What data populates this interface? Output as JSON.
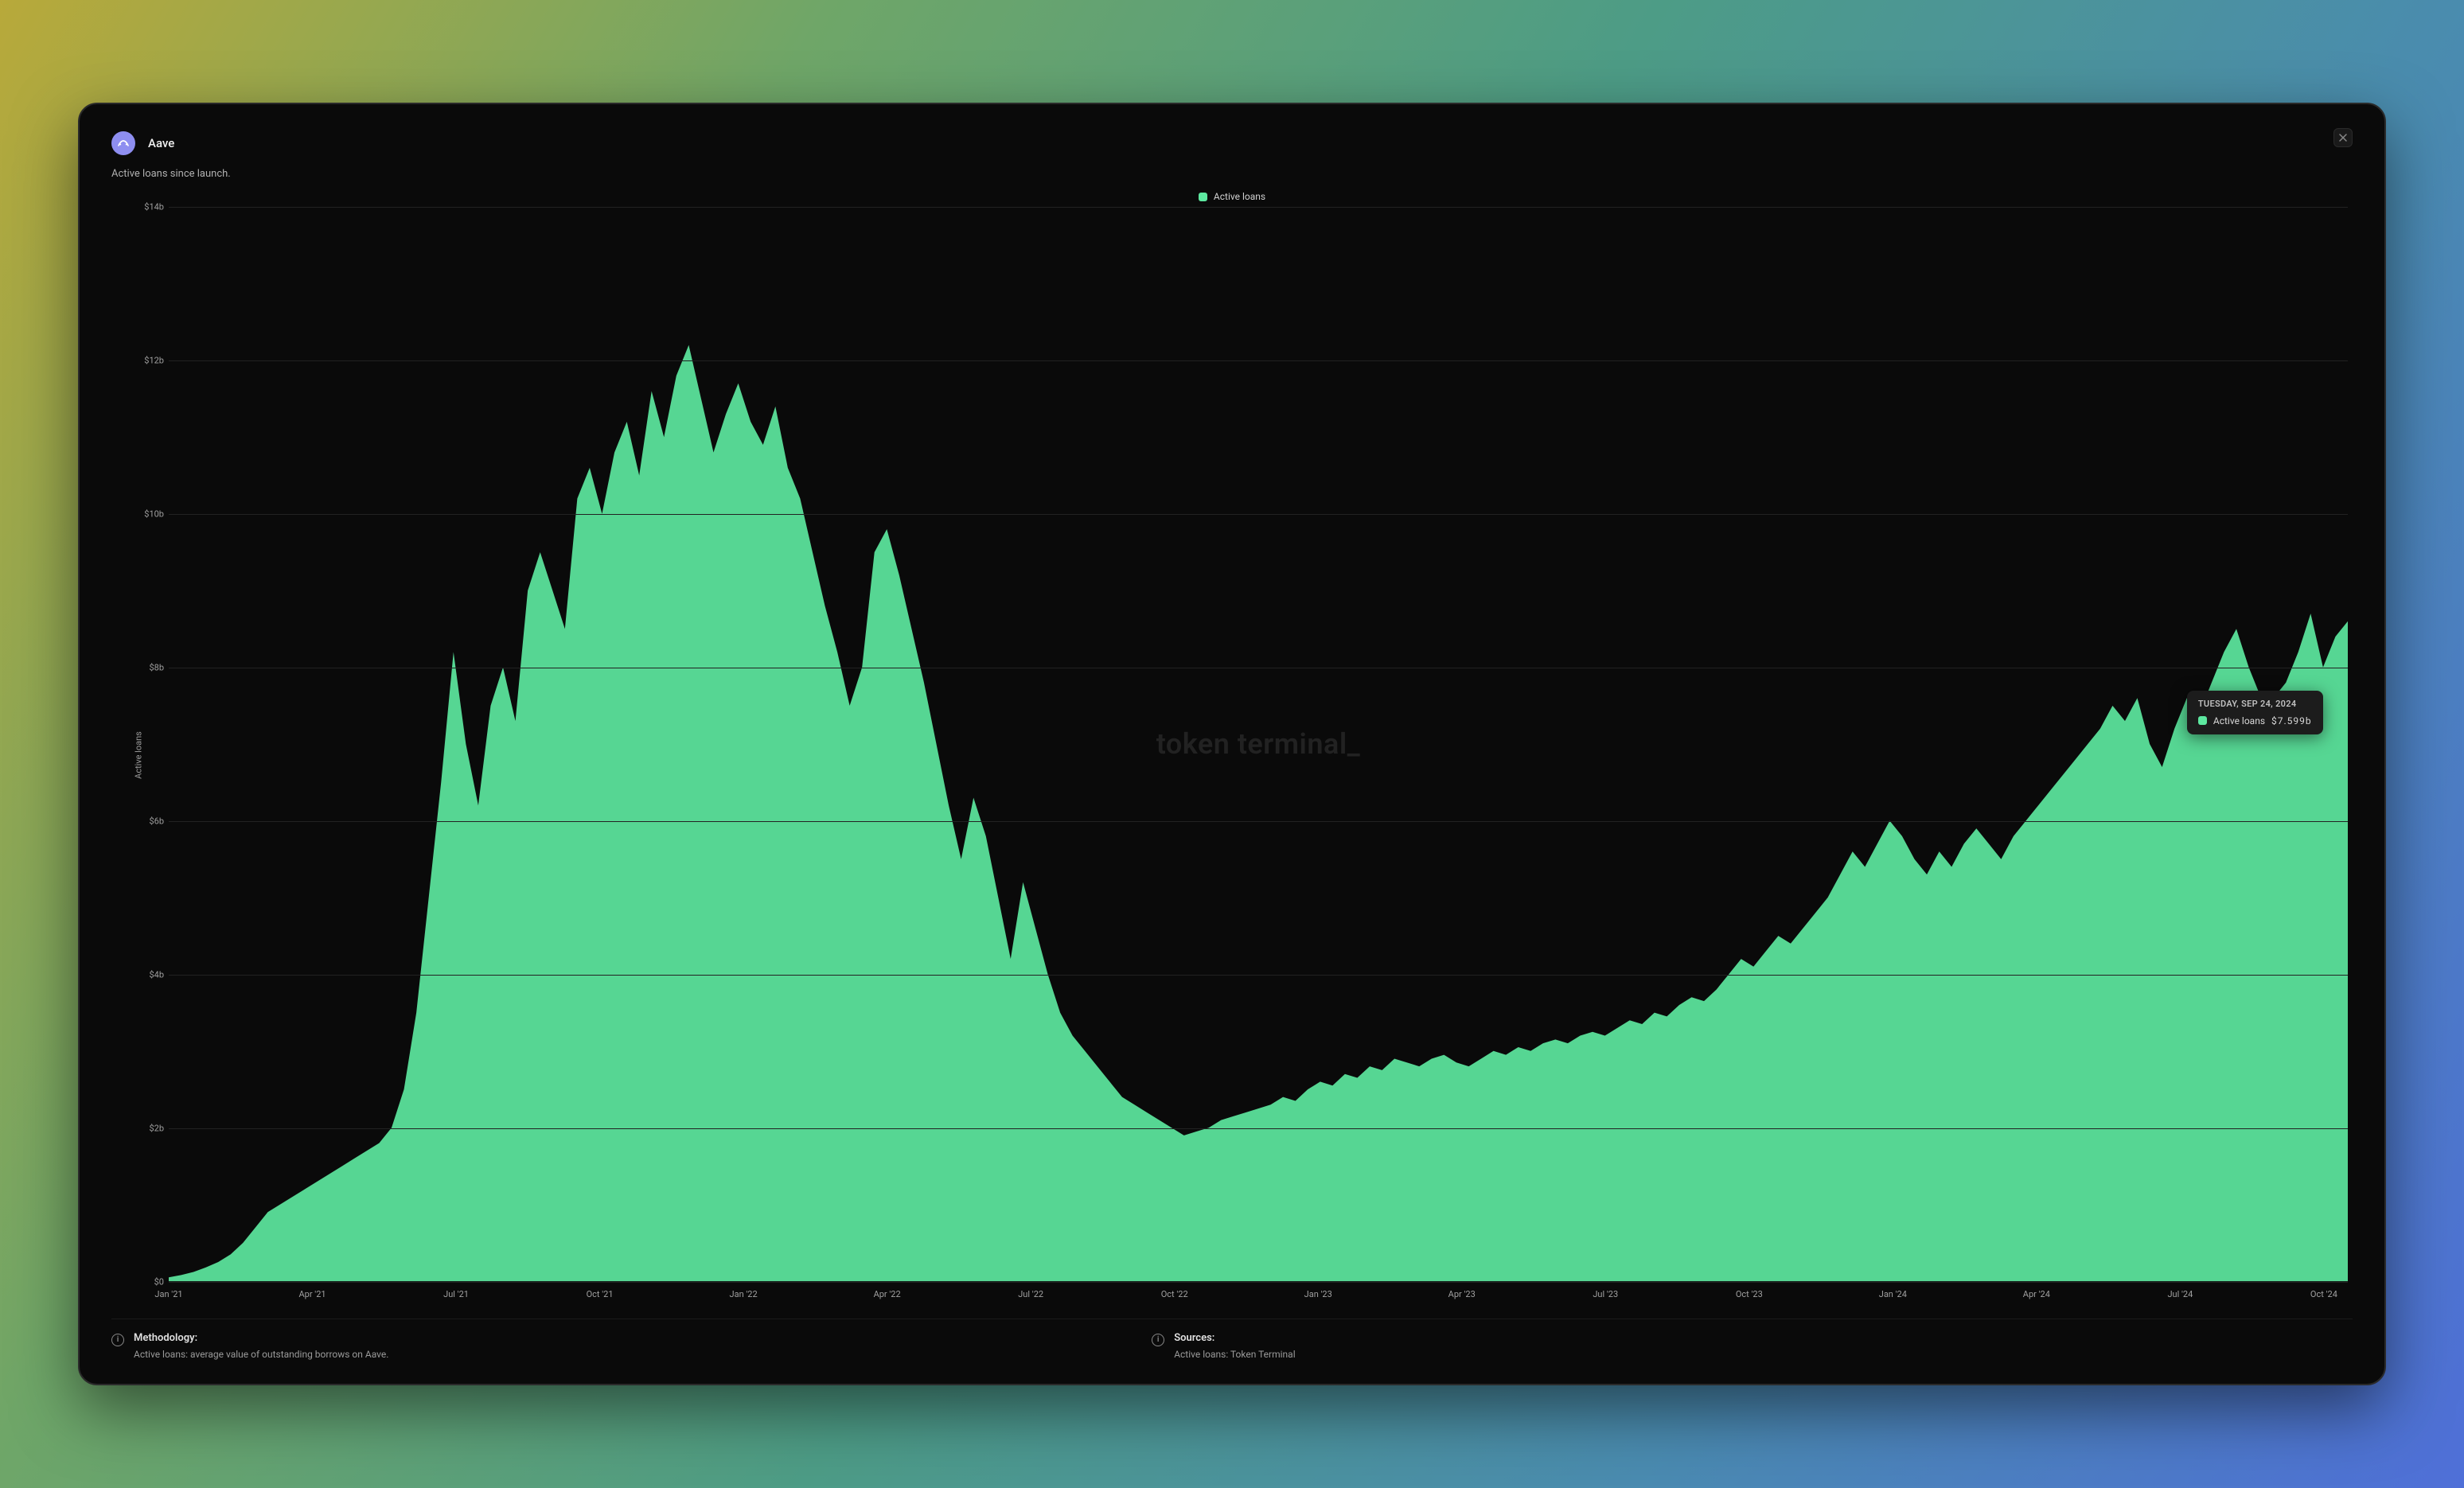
{
  "header": {
    "title": "Aave",
    "subtitle": "Active loans since launch."
  },
  "legend": {
    "series_label": "Active loans",
    "color": "#5de8a0"
  },
  "y_axis_label": "Active loans",
  "watermark": "token terminal_",
  "tooltip": {
    "date": "TUESDAY, SEP 24, 2024",
    "series": "Active loans",
    "value": "$7.599b"
  },
  "footer": {
    "methodology_heading": "Methodology:",
    "methodology_body": "Active loans: average value of outstanding borrows on Aave.",
    "sources_heading": "Sources:",
    "sources_body": "Active loans: Token Terminal"
  },
  "chart_data": {
    "type": "area",
    "title": "Aave — Active loans since launch",
    "xlabel": "",
    "ylabel": "Active loans",
    "ylim": [
      0,
      14
    ],
    "y_ticks": [
      0,
      2,
      4,
      6,
      8,
      10,
      12,
      14
    ],
    "y_tick_labels": [
      "$0",
      "$2b",
      "$4b",
      "$6b",
      "$8b",
      "$10b",
      "$12b",
      "$14b"
    ],
    "x_tick_labels": [
      "Jan '21",
      "Apr '21",
      "Jul '21",
      "Oct '21",
      "Jan '22",
      "Apr '22",
      "Jul '22",
      "Oct '22",
      "Jan '23",
      "Apr '23",
      "Jul '23",
      "Oct '23",
      "Jan '24",
      "Apr '24",
      "Jul '24",
      "Oct '24"
    ],
    "x_tick_positions_months": [
      0,
      3,
      6,
      9,
      12,
      15,
      18,
      21,
      24,
      27,
      30,
      33,
      36,
      39,
      42,
      45
    ],
    "x_range_months": [
      0,
      45.5
    ],
    "unit": "billion USD",
    "series": [
      {
        "name": "Active loans",
        "color": "#5de8a0",
        "values": [
          0.05,
          0.08,
          0.12,
          0.18,
          0.25,
          0.35,
          0.5,
          0.7,
          0.9,
          1.0,
          1.1,
          1.2,
          1.3,
          1.4,
          1.5,
          1.6,
          1.7,
          1.8,
          2.0,
          2.5,
          3.5,
          5.0,
          6.5,
          8.2,
          7.0,
          6.2,
          7.5,
          8.0,
          7.3,
          9.0,
          9.5,
          9.0,
          8.5,
          10.2,
          10.6,
          10.0,
          10.8,
          11.2,
          10.5,
          11.6,
          11.0,
          11.8,
          12.2,
          11.5,
          10.8,
          11.3,
          11.7,
          11.2,
          10.9,
          11.4,
          10.6,
          10.2,
          9.5,
          8.8,
          8.2,
          7.5,
          8.0,
          9.5,
          9.8,
          9.2,
          8.5,
          7.8,
          7.0,
          6.2,
          5.5,
          6.3,
          5.8,
          5.0,
          4.2,
          5.2,
          4.6,
          4.0,
          3.5,
          3.2,
          3.0,
          2.8,
          2.6,
          2.4,
          2.3,
          2.2,
          2.1,
          2.0,
          1.9,
          1.95,
          2.0,
          2.1,
          2.15,
          2.2,
          2.25,
          2.3,
          2.4,
          2.35,
          2.5,
          2.6,
          2.55,
          2.7,
          2.65,
          2.8,
          2.75,
          2.9,
          2.85,
          2.8,
          2.9,
          2.95,
          2.85,
          2.8,
          2.9,
          3.0,
          2.95,
          3.05,
          3.0,
          3.1,
          3.15,
          3.1,
          3.2,
          3.25,
          3.2,
          3.3,
          3.4,
          3.35,
          3.5,
          3.45,
          3.6,
          3.7,
          3.65,
          3.8,
          4.0,
          4.2,
          4.1,
          4.3,
          4.5,
          4.4,
          4.6,
          4.8,
          5.0,
          5.3,
          5.6,
          5.4,
          5.7,
          6.0,
          5.8,
          5.5,
          5.3,
          5.6,
          5.4,
          5.7,
          5.9,
          5.7,
          5.5,
          5.8,
          6.0,
          6.2,
          6.4,
          6.6,
          6.8,
          7.0,
          7.2,
          7.5,
          7.3,
          7.6,
          7.0,
          6.7,
          7.2,
          7.6,
          7.4,
          7.8,
          8.2,
          8.5,
          8.0,
          7.6,
          7.599,
          7.8,
          8.2,
          8.7,
          8.0,
          8.4,
          8.6
        ]
      }
    ],
    "tooltip_sample": {
      "date": "2024-09-24",
      "value": 7.599
    }
  }
}
